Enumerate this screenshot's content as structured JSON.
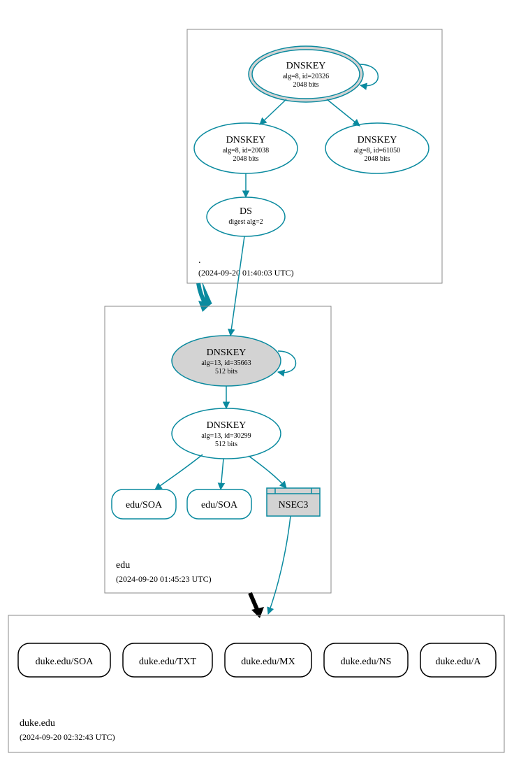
{
  "colors": {
    "teal": "#0a8a9f",
    "gray_fill": "#d3d3d3",
    "box_stroke": "#888"
  },
  "zones": {
    "root": {
      "name": ".",
      "timestamp": "(2024-09-20 01:40:03 UTC)"
    },
    "edu": {
      "name": "edu",
      "timestamp": "(2024-09-20 01:45:23 UTC)"
    },
    "duke": {
      "name": "duke.edu",
      "timestamp": "(2024-09-20 02:32:43 UTC)"
    }
  },
  "nodes": {
    "root_ksk": {
      "title": "DNSKEY",
      "line2": "alg=8, id=20326",
      "line3": "2048 bits"
    },
    "root_zsk1": {
      "title": "DNSKEY",
      "line2": "alg=8, id=20038",
      "line3": "2048 bits"
    },
    "root_zsk2": {
      "title": "DNSKEY",
      "line2": "alg=8, id=61050",
      "line3": "2048 bits"
    },
    "root_ds": {
      "title": "DS",
      "line2": "digest alg=2"
    },
    "edu_ksk": {
      "title": "DNSKEY",
      "line2": "alg=13, id=35663",
      "line3": "512 bits"
    },
    "edu_zsk": {
      "title": "DNSKEY",
      "line2": "alg=13, id=30299",
      "line3": "512 bits"
    },
    "edu_soa1": {
      "title": "edu/SOA"
    },
    "edu_soa2": {
      "title": "edu/SOA"
    },
    "edu_nsec3": {
      "title": "NSEC3"
    },
    "duke_soa": {
      "title": "duke.edu/SOA"
    },
    "duke_txt": {
      "title": "duke.edu/TXT"
    },
    "duke_mx": {
      "title": "duke.edu/MX"
    },
    "duke_ns": {
      "title": "duke.edu/NS"
    },
    "duke_a": {
      "title": "duke.edu/A"
    }
  }
}
